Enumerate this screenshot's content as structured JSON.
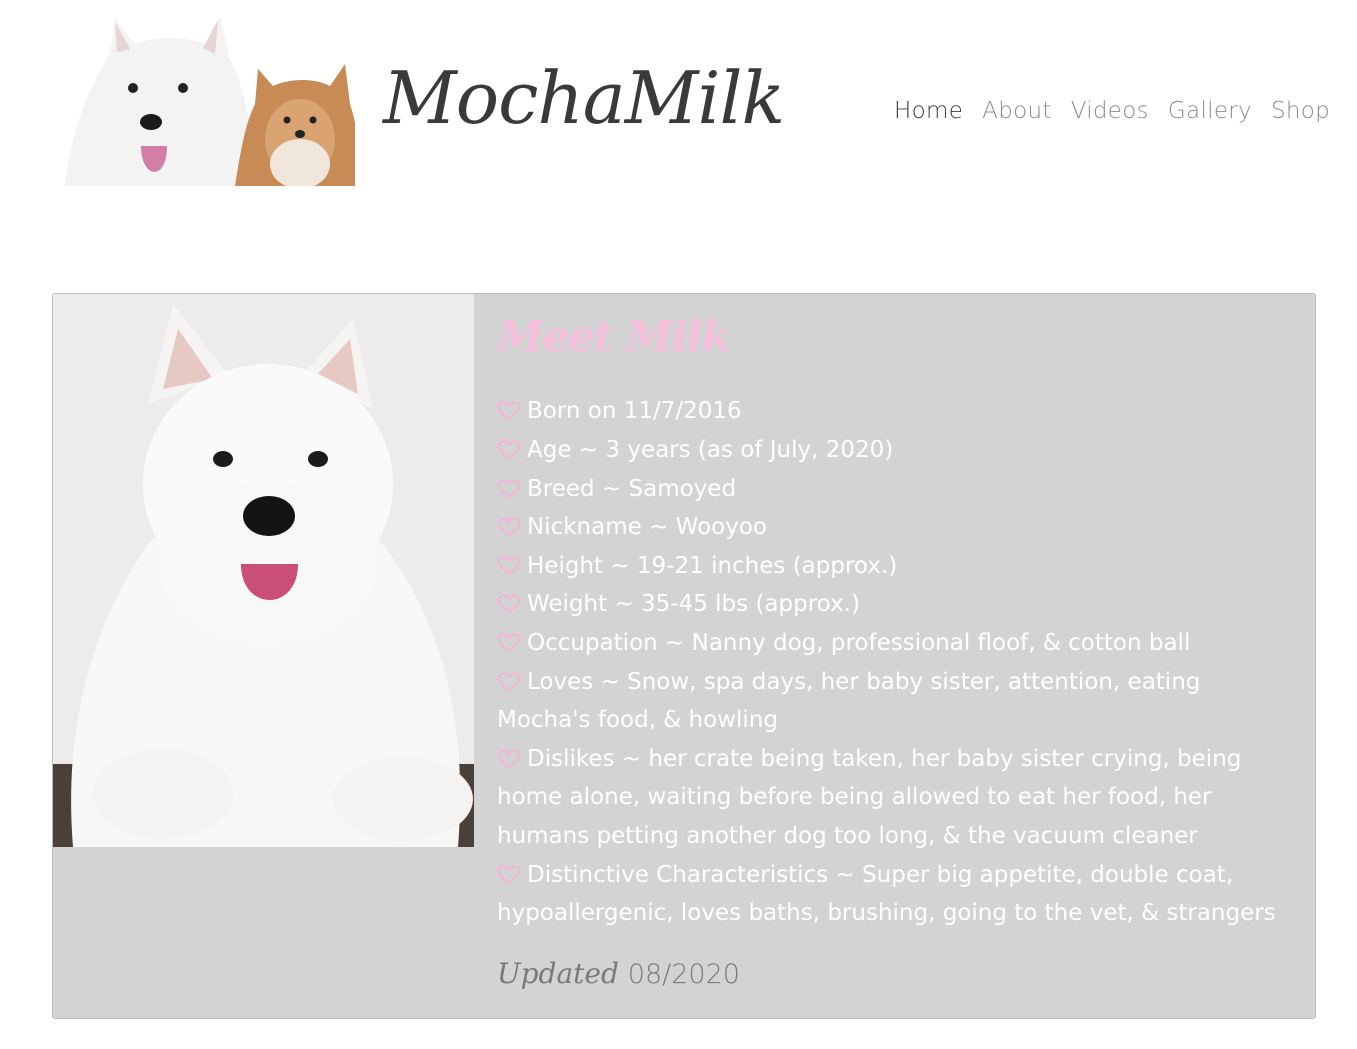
{
  "header": {
    "site_title": "MochaMilk",
    "nav": [
      {
        "label": "Home",
        "active": true
      },
      {
        "label": "About",
        "active": false
      },
      {
        "label": "Videos",
        "active": false
      },
      {
        "label": "Gallery",
        "active": false
      },
      {
        "label": "Shop",
        "active": false
      }
    ]
  },
  "profile": {
    "heading": "Meet Milk",
    "facts": [
      "Born on 11/7/2016",
      "Age ~ 3 years (as of July, 2020)",
      "Breed ~ Samoyed",
      "Nickname ~ Wooyoo",
      "Height ~ 19-21 inches (approx.)",
      "Weight ~ 35-45 lbs (approx.)",
      "Occupation ~ Nanny dog, professional floof, & cotton ball",
      "Loves ~ Snow, spa days, her baby sister, attention, eating Mocha's food, & howling",
      "Dislikes ~ her crate being taken, her baby sister crying, being home alone, waiting before being allowed to eat her food, her humans petting another dog too long, & the vacuum cleaner",
      "Distinctive Characteristics ~ Super big appetite, double coat, hypoallergenic, loves baths, brushing, going to the vet, & strangers"
    ],
    "updated_label": "Updated",
    "updated_date": "08/2020"
  },
  "colors": {
    "card_bg": "#d3d3d3",
    "heading_pink": "#f5bfdc",
    "heart_pink": "#f7b3d6",
    "nav_active": "#3b3b3b",
    "nav_inactive": "#8b8b8b"
  },
  "icons": {
    "fact_bullet": "heart-outline-icon"
  }
}
